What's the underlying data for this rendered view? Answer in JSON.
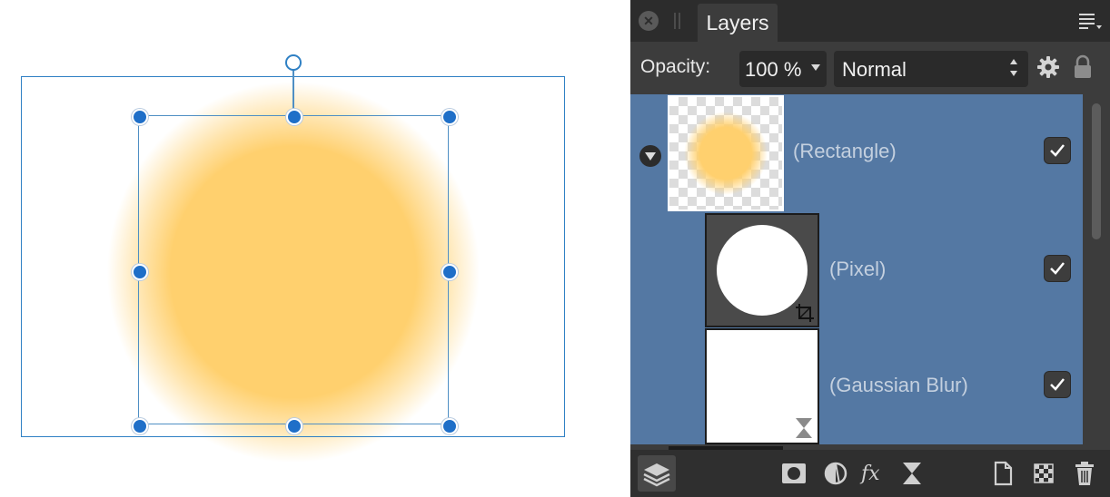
{
  "panel": {
    "tab_label": "Layers",
    "opacity_label": "Opacity:",
    "opacity_value": "100 %",
    "blend_mode": "Normal"
  },
  "layers": [
    {
      "name": "(Rectangle)",
      "visible": true,
      "expanded": true
    },
    {
      "name": "(Pixel)",
      "visible": true
    },
    {
      "name": "(Gaussian Blur)",
      "visible": true
    }
  ],
  "icons": {
    "close": "close-icon",
    "panel_menu": "hamburger-menu-icon",
    "gear": "gear-icon",
    "lock": "lock-icon",
    "expand": "disclosure-triangle-icon",
    "check": "checkmark-icon",
    "crop": "crop-icon",
    "hourglass": "hourglass-icon",
    "layers_toggle": "layers-stack-icon",
    "mask": "mask-icon",
    "adjustment": "adjustment-icon",
    "fx": "fx-icon",
    "live_filter": "live-filter-icon",
    "add_layer": "add-layer-icon",
    "add_pixel_layer": "checker-layer-icon",
    "delete": "trash-icon"
  },
  "colors": {
    "selection": "#5478a3",
    "panel_bg": "#3c3c3c",
    "circle_fill": "#ffd06e",
    "handle_blue": "#1f6fc8",
    "bbox_blue": "#2f80c4"
  }
}
